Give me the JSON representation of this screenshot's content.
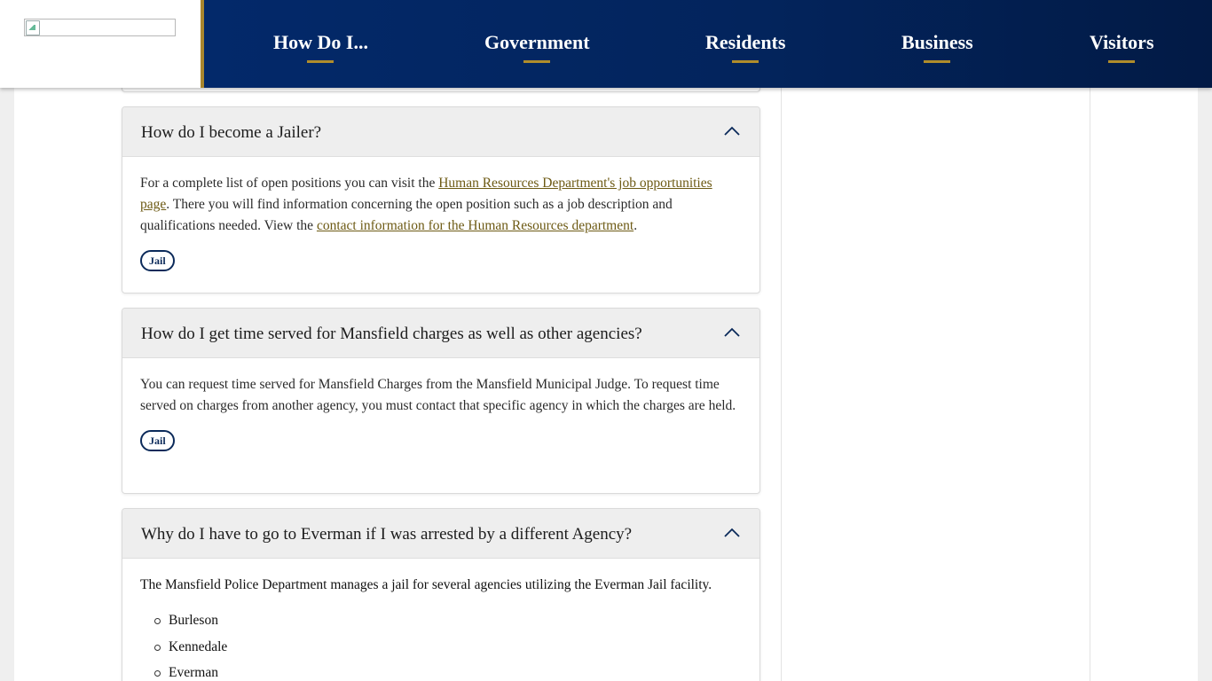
{
  "header": {
    "nav": [
      {
        "label": "How Do I..."
      },
      {
        "label": "Government"
      },
      {
        "label": "Residents"
      },
      {
        "label": "Business"
      },
      {
        "label": "Visitors"
      }
    ]
  },
  "faqs": [
    {
      "question": "How do I become a Jailer?",
      "answer_pre": "For a complete list of open positions you can visit the ",
      "link1": "Human Resources Department's job opportunities page",
      "answer_mid": ". There you will find information concerning the open position such as a job description and qualifications needed. View the ",
      "link2": "contact information for the Human Resources department",
      "answer_post": ".",
      "tag": "Jail"
    },
    {
      "question": "How do I get time served for Mansfield charges as well as other agencies?",
      "answer": "You can request time served for Mansfield Charges from the Mansfield Municipal Judge. To request time served on charges from another agency, you must contact that specific agency in which the charges are held.",
      "tag": "Jail"
    },
    {
      "question": "Why do I have to go to Everman if I was arrested by a different Agency?",
      "answer": "The Mansfield Police Department manages a jail for several agencies utilizing the Everman Jail facility.",
      "agencies": [
        "Burleson",
        "Kennedale",
        "Everman"
      ]
    }
  ],
  "colors": {
    "nav_bg": "#03296a",
    "accent_gold": "#b08d2b",
    "link": "#6d5a14",
    "tag_border": "#0b2a5a"
  }
}
